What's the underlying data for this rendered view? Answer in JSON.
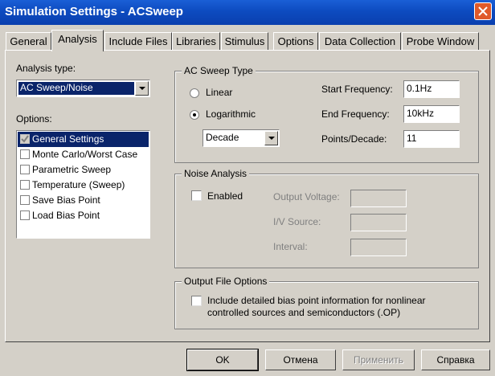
{
  "window": {
    "title": "Simulation Settings - ACSweep"
  },
  "tabs": [
    {
      "label": "General"
    },
    {
      "label": "Analysis"
    },
    {
      "label": "Include Files"
    },
    {
      "label": "Libraries"
    },
    {
      "label": "Stimulus"
    },
    {
      "label": "Options"
    },
    {
      "label": "Data Collection"
    },
    {
      "label": "Probe Window"
    }
  ],
  "analysis_type": {
    "label": "Analysis type:",
    "value": "AC Sweep/Noise"
  },
  "options": {
    "label": "Options:",
    "items": [
      {
        "label": "General Settings",
        "checked": true,
        "selected": true
      },
      {
        "label": "Monte Carlo/Worst Case",
        "checked": false
      },
      {
        "label": "Parametric Sweep",
        "checked": false
      },
      {
        "label": "Temperature (Sweep)",
        "checked": false
      },
      {
        "label": "Save Bias Point",
        "checked": false
      },
      {
        "label": "Load Bias Point",
        "checked": false
      }
    ]
  },
  "ac_sweep": {
    "title": "AC Sweep Type",
    "linear_label": "Linear",
    "log_label": "Logarithmic",
    "selected": "Logarithmic",
    "log_mode": "Decade",
    "start_label": "Start Frequency:",
    "start_value": "0.1Hz",
    "end_label": "End Frequency:",
    "end_value": "10kHz",
    "points_label": "Points/Decade:",
    "points_value": "11"
  },
  "noise": {
    "title": "Noise Analysis",
    "enabled_label": "Enabled",
    "output_voltage_label": "Output Voltage:",
    "iv_source_label": "I/V Source:",
    "interval_label": "Interval:"
  },
  "output_file": {
    "title": "Output File Options",
    "checkbox_label_line1": "Include detailed bias point information for nonlinear",
    "checkbox_label_line2": "controlled sources and semiconductors (.OP)"
  },
  "buttons": {
    "ok": "OK",
    "cancel": "Отмена",
    "apply": "Применить",
    "help": "Справка"
  },
  "colors": {
    "titlebar": "#0d4bc0",
    "selection": "#0a246a",
    "face": "#d4d0c8"
  }
}
